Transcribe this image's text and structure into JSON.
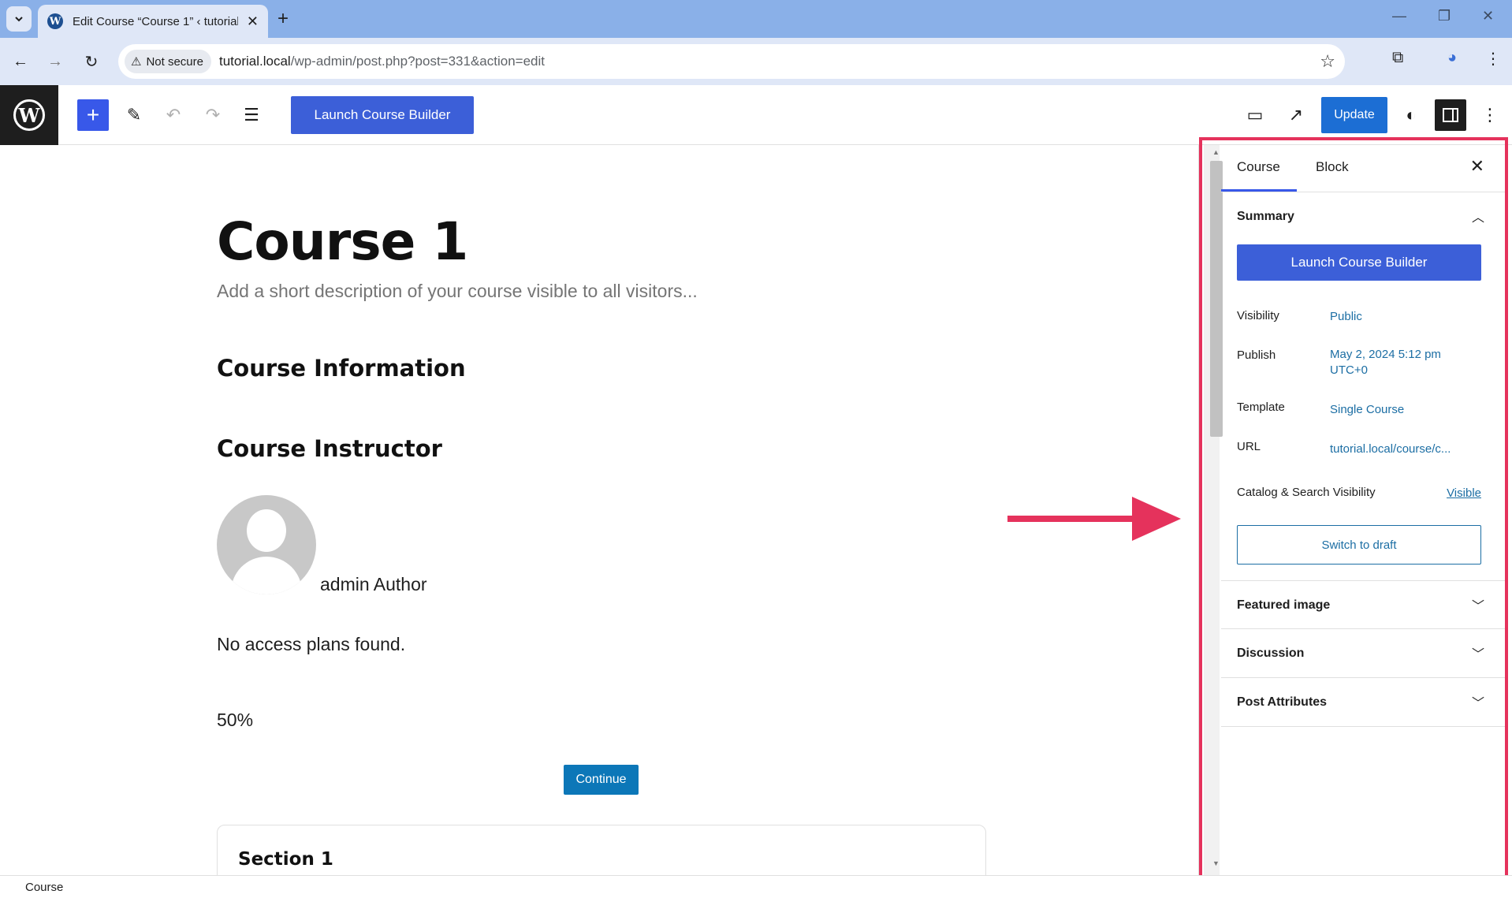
{
  "browser": {
    "tab_title": "Edit Course “Course 1” ‹ tutorial",
    "security_label": "Not secure",
    "url_host": "tutorial.local",
    "url_path": "/wp-admin/post.php?post=331&action=edit"
  },
  "toolbar": {
    "launch_label": "Launch Course Builder",
    "update_label": "Update"
  },
  "editor": {
    "title": "Course 1",
    "description_placeholder": "Add a short description of your course visible to all visitors...",
    "heading_info": "Course Information",
    "heading_instructor": "Course Instructor",
    "author_name": "admin Author",
    "access_plans": "No access plans found.",
    "progress": "50%",
    "continue_label": "Continue",
    "section_title": "Section 1"
  },
  "sidebar": {
    "tab_course": "Course",
    "tab_block": "Block",
    "summary_label": "Summary",
    "launch_label": "Launch Course Builder",
    "visibility_label": "Visibility",
    "visibility_value": "Public",
    "publish_label": "Publish",
    "publish_value_1": "May 2, 2024 5:12 pm",
    "publish_value_2": "UTC+0",
    "template_label": "Template",
    "template_value": "Single Course",
    "url_label": "URL",
    "url_value": "tutorial.local/course/c...",
    "catalog_label": "Catalog & Search Visibility",
    "catalog_value": "Visible",
    "draft_label": "Switch to draft",
    "featured_image_label": "Featured image",
    "discussion_label": "Discussion",
    "post_attributes_label": "Post Attributes"
  },
  "status": {
    "breadcrumb": "Course"
  },
  "colors": {
    "accent": "#3858e9",
    "highlight": "#e5325c",
    "link": "#1c6ea4"
  }
}
